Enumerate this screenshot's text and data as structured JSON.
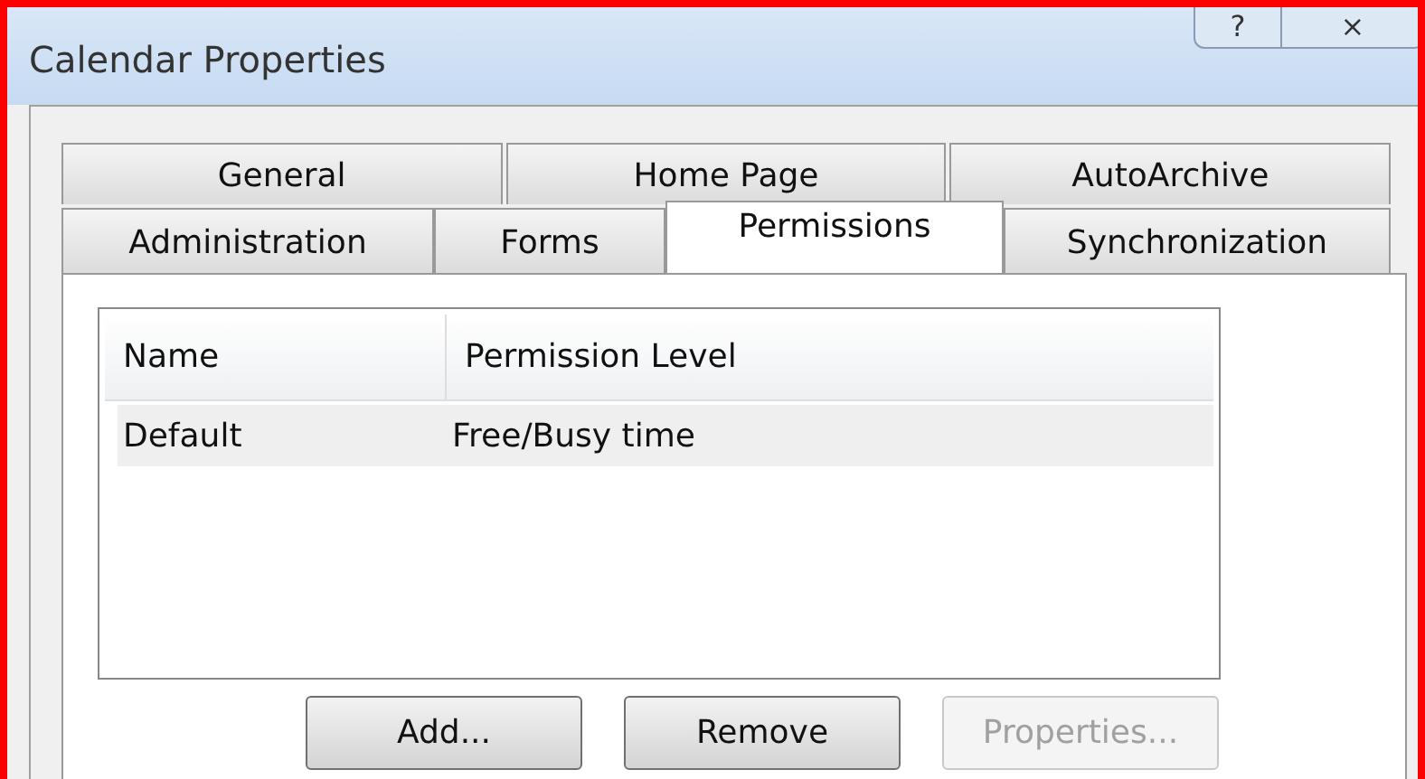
{
  "window": {
    "title": "Calendar Properties",
    "controls": [
      "?",
      "⨯"
    ]
  },
  "tab_rows": [
    [
      {
        "label": "General",
        "selected": false
      },
      {
        "label": "Home Page",
        "selected": false
      },
      {
        "label": "AutoArchive",
        "selected": false
      }
    ],
    [
      {
        "label": "Administration",
        "selected": false
      },
      {
        "label": "Forms",
        "selected": false
      },
      {
        "label": "Permissions",
        "selected": true
      },
      {
        "label": "Synchronization",
        "selected": false
      }
    ]
  ],
  "table": {
    "columns": [
      "Name",
      "Permission Level"
    ],
    "rows": [
      {
        "cells": [
          "Default",
          "Free/Busy time"
        ],
        "selected": true
      }
    ]
  },
  "buttons": [
    {
      "label": "Add...",
      "disabled": false
    },
    {
      "label": "Remove",
      "disabled": false
    },
    {
      "label": "Properties...",
      "disabled": true
    }
  ]
}
